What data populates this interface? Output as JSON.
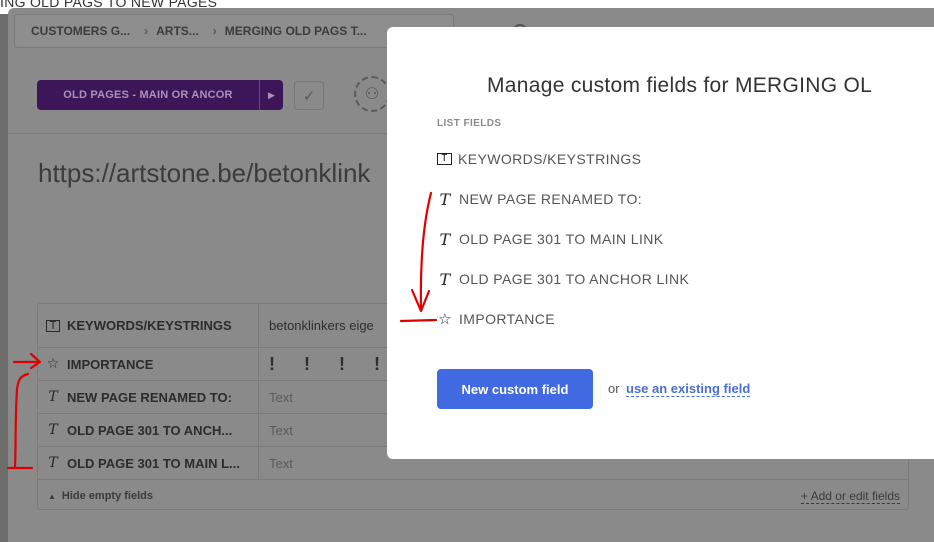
{
  "page": {
    "top_title": "ING OLD PAGS TO NEW PAGES"
  },
  "breadcrumb": [
    "CUSTOMERS G...",
    "ARTS...",
    "MERGING OLD PAGS T..."
  ],
  "task": {
    "status_label": "OLD PAGES - MAIN OR ANCOR",
    "url_text": "https://artstone.be/betonklink"
  },
  "fields": [
    {
      "icon": "dropdown-field-icon",
      "name": "KEYWORDS/KEYSTRINGS",
      "value": "betonklinkers eige"
    },
    {
      "icon": "star-icon",
      "name": "IMPORTANCE",
      "value": "! ! ! ! !"
    },
    {
      "icon": "text-field-icon",
      "name": "NEW PAGE RENAMED TO:",
      "value": "Text"
    },
    {
      "icon": "text-field-icon",
      "name": "OLD PAGE 301 TO ANCH...",
      "value": "Text"
    },
    {
      "icon": "text-field-icon",
      "name": "OLD PAGE 301 TO MAIN L...",
      "value": "Text"
    }
  ],
  "fields_footer": {
    "hide_empty": "Hide empty fields",
    "add_edit": "+ Add or edit fields"
  },
  "modal": {
    "title": "Manage custom fields for MERGING OL",
    "section_label": "LIST FIELDS",
    "fields": [
      {
        "icon": "dropdown-field-icon",
        "name": "KEYWORDS/KEYSTRINGS"
      },
      {
        "icon": "text-field-icon",
        "name": "NEW PAGE RENAMED TO:"
      },
      {
        "icon": "text-field-icon",
        "name": "OLD PAGE 301 TO MAIN LINK"
      },
      {
        "icon": "text-field-icon",
        "name": "OLD PAGE 301 TO ANCHOR LINK"
      },
      {
        "icon": "star-icon",
        "name": "IMPORTANCE"
      }
    ],
    "new_button": "New custom field",
    "or_text": "or",
    "existing_link": "use an existing field"
  },
  "colors": {
    "accent": "#4169e1",
    "status": "#3c1658",
    "annotation": "#e00000"
  }
}
